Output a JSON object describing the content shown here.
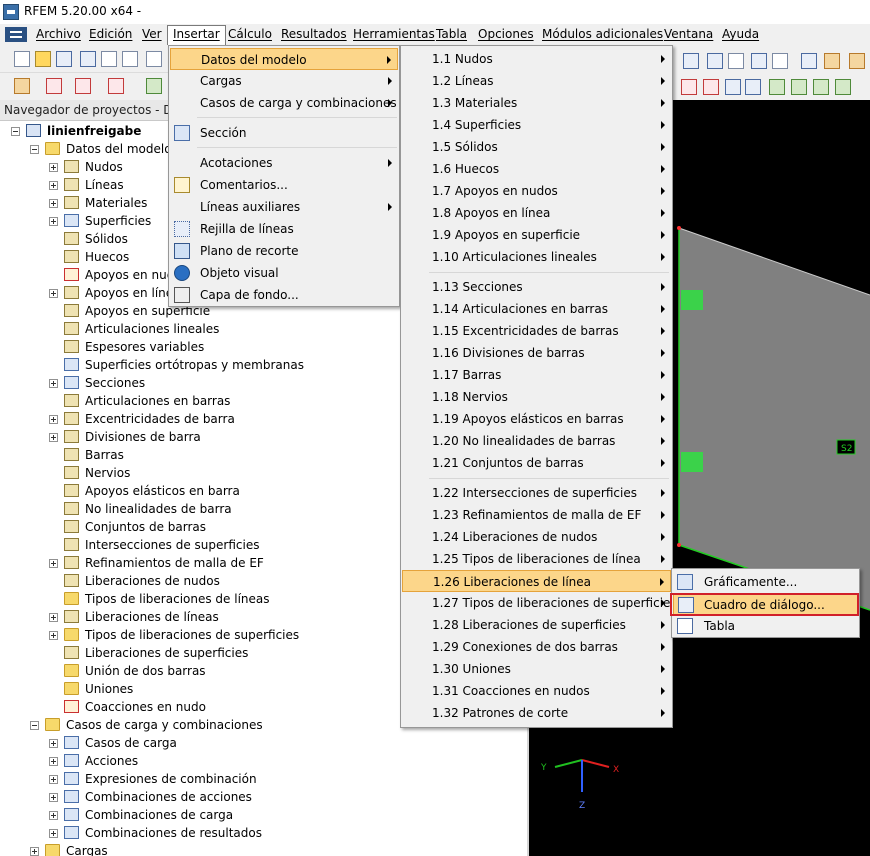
{
  "window": {
    "title": "RFEM 5.20.00 x64 -"
  },
  "menubar": {
    "items": [
      "Archivo",
      "Edición",
      "Ver",
      "Insertar",
      "Cálculo",
      "Resultados",
      "Herramientas",
      "Tabla",
      "Opciones",
      "Módulos adicionales",
      "Ventana",
      "Ayuda"
    ],
    "active": "Insertar"
  },
  "navigator": {
    "header": "Navegador de proyectos - Datos",
    "project": "linienfreigabe",
    "model_data": "Datos del modelo",
    "items": [
      "Nudos",
      "Líneas",
      "Materiales",
      "Superficies",
      "Sólidos",
      "Huecos",
      "Apoyos en nudos",
      "Apoyos en líneas",
      "Apoyos en superficie",
      "Articulaciones lineales",
      "Espesores variables",
      "Superficies ortótropas y membranas",
      "Secciones",
      "Articulaciones en barras",
      "Excentricidades de barra",
      "Divisiones de barra",
      "Barras",
      "Nervios",
      "Apoyos elásticos en barra",
      "No linealidades de barra",
      "Conjuntos de barras",
      "Intersecciones de superficies",
      "Refinamientos de malla de EF",
      "Liberaciones de nudos",
      "Tipos de liberaciones de líneas",
      "Liberaciones de líneas",
      "Tipos de liberaciones de superficies",
      "Liberaciones de superficies",
      "Unión de dos barras",
      "Uniones",
      "Coacciones en nudo"
    ],
    "loads_group": "Casos de carga y combinaciones",
    "load_items": [
      "Casos de carga",
      "Acciones",
      "Expresiones de combinación",
      "Combinaciones de acciones",
      "Combinaciones de carga",
      "Combinaciones de resultados"
    ],
    "last_item": "Cargas"
  },
  "insert_menu": {
    "items": [
      "Datos del modelo",
      "Cargas",
      "Casos de carga y combinaciones",
      "Sección",
      "Acotaciones",
      "Comentarios...",
      "Líneas auxiliares",
      "Rejilla de líneas",
      "Plano de recorte",
      "Objeto visual",
      "Capa de fondo..."
    ]
  },
  "model_data_menu": {
    "items": [
      "1.1 Nudos",
      "1.2 Líneas",
      "1.3 Materiales",
      "1.4 Superficies",
      "1.5 Sólidos",
      "1.6 Huecos",
      "1.7 Apoyos en nudos",
      "1.8 Apoyos en línea",
      "1.9 Apoyos en superficie",
      "1.10 Articulaciones lineales",
      "1.13 Secciones",
      "1.14 Articulaciones en barras",
      "1.15 Excentricidades de barras",
      "1.16 Divisiones de barras",
      "1.17 Barras",
      "1.18 Nervios",
      "1.19 Apoyos elásticos en barras",
      "1.20 No linealidades de barras",
      "1.21 Conjuntos de barras",
      "1.22 Intersecciones de superficies",
      "1.23 Refinamientos de malla de EF",
      "1.24 Liberaciones de nudos",
      "1.25 Tipos de liberaciones de línea",
      "1.26 Liberaciones de línea",
      "1.27 Tipos de liberaciones de superficies",
      "1.28 Liberaciones de superficies",
      "1.29 Conexiones de dos barras",
      "1.30 Uniones",
      "1.31 Coacciones en nudos",
      "1.32 Patrones de corte"
    ],
    "highlighted": "1.26 Liberaciones de línea"
  },
  "release_submenu": {
    "items": [
      "Gráficamente...",
      "Cuadro de diálogo...",
      "Tabla"
    ],
    "highlighted": "Cuadro de diálogo..."
  },
  "view3d": {
    "surface_label": "S2",
    "axes": {
      "x": "X",
      "y": "Y",
      "z": "Z"
    },
    "colors": {
      "background": "#000000",
      "surface": "#808080",
      "edge": "#22cc22",
      "axis_x": "#e02020",
      "axis_y": "#20c020",
      "axis_z": "#3060ff"
    }
  },
  "toolbar_icons": [
    "new-file-icon",
    "open-folder-icon",
    "save-icon",
    "print-icon",
    "undo-icon",
    "redo-icon"
  ]
}
